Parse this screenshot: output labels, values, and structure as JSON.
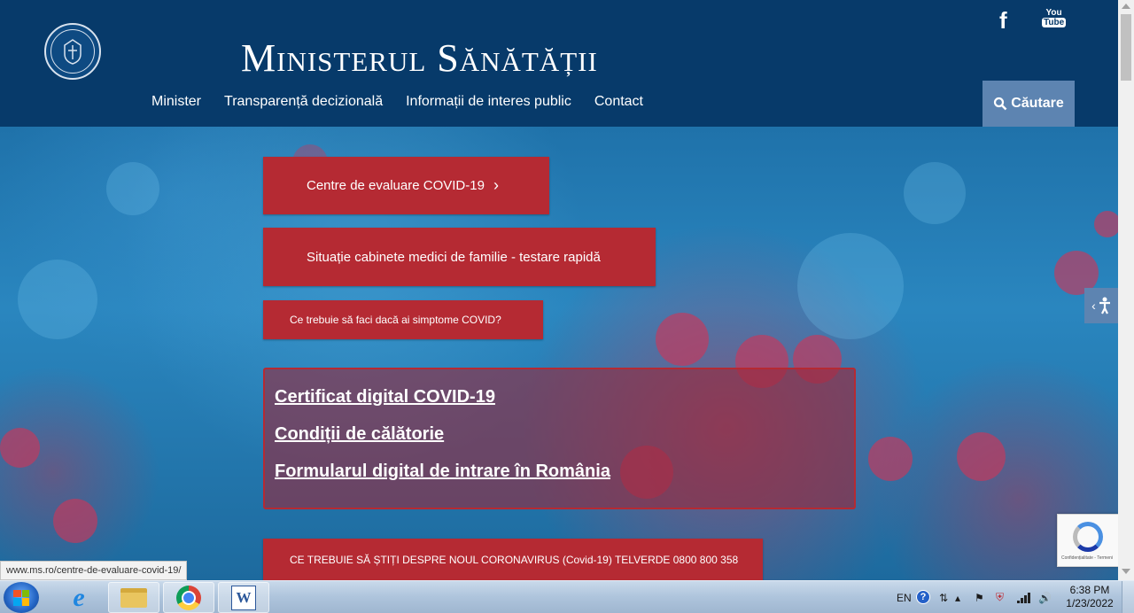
{
  "header": {
    "site_title": "Ministerul Sănătății",
    "logo_label": "Guvernul României",
    "nav": [
      "Minister",
      "Transparență decizională",
      "Informații de interes public",
      "Contact"
    ],
    "search_label": "Căutare",
    "social": {
      "facebook": "f",
      "youtube_top": "You",
      "youtube_bottom": "Tube"
    },
    "bg_color": "#073a6a",
    "accent_color": "#5d84b1"
  },
  "hero": {
    "btn_covid_centers": "Centre de evaluare COVID-19",
    "btn_family_doctors": "Situație cabinete medici de familie - testare rapidă",
    "btn_symptoms": "Ce trebuie să faci dacă ai simptome COVID?",
    "links": [
      "Certificat digital COVID-19",
      "Condiții de călătorie",
      "Formularul digital de intrare în România"
    ],
    "btn_coronavirus_info": "CE TREBUIE SĂ ȘTIȚI DESPRE NOUL CORONAVIRUS (Covid-19) TELVERDE 0800 800 358",
    "button_color": "#b52a33"
  },
  "recaptcha_text": "Confidențialitate - Termeni",
  "status_url": "www.ms.ro/centre-de-evaluare-covid-19/",
  "taskbar": {
    "apps": [
      "internet-explorer",
      "windows-explorer",
      "google-chrome",
      "microsoft-word"
    ],
    "language": "EN",
    "help": "?",
    "time": "6:38 PM",
    "date": "1/23/2022"
  }
}
